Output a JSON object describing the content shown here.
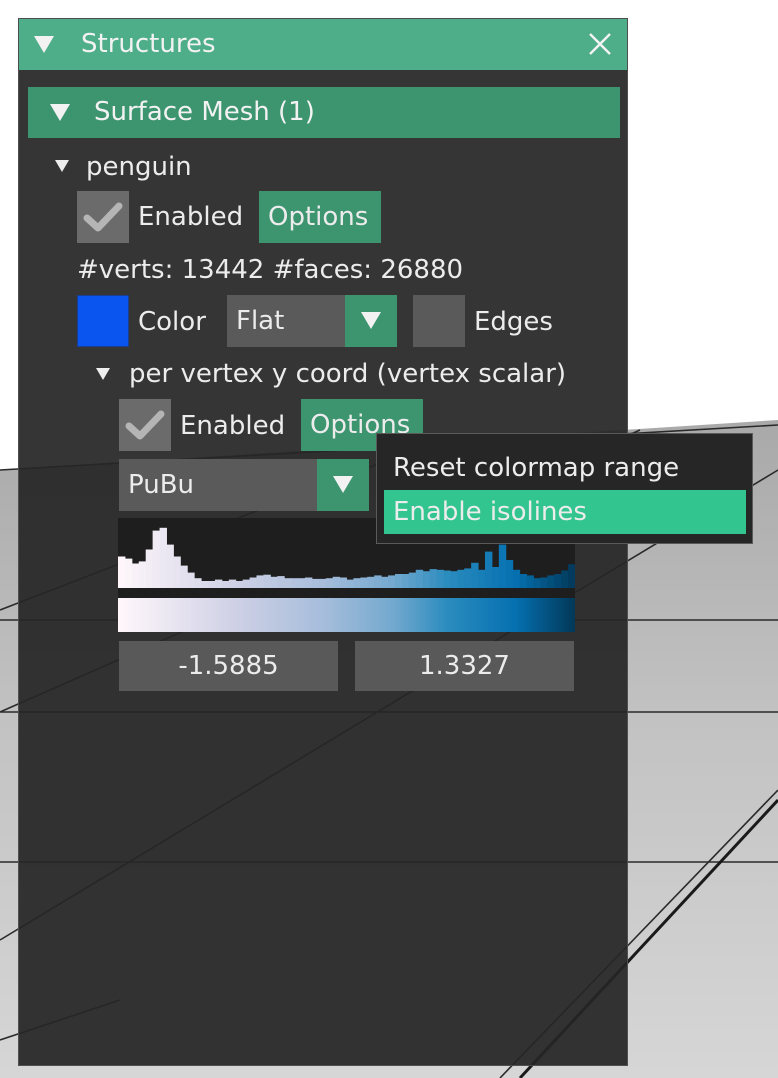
{
  "panel": {
    "title": "Structures",
    "group_header": "Surface Mesh (1)",
    "structure": {
      "name": "penguin",
      "enabled_label": "Enabled",
      "enabled_checked": true,
      "options_label": "Options",
      "stats": "#verts: 13442  #faces: 26880",
      "color_label": "Color",
      "color_value": "#0a55f0",
      "shade_mode": "Flat",
      "edges_label": "Edges",
      "edges_checked": false,
      "quantity": {
        "name": "per vertex y coord (vertex scalar)",
        "enabled_label": "Enabled",
        "enabled_checked": true,
        "options_label": "Options",
        "colormap": "PuBu",
        "range_min": "-1.5885",
        "range_max": "1.3327",
        "histogram": [
          0.45,
          0.42,
          0.35,
          0.38,
          0.55,
          0.82,
          0.86,
          0.62,
          0.45,
          0.32,
          0.22,
          0.14,
          0.1,
          0.1,
          0.12,
          0.1,
          0.12,
          0.1,
          0.12,
          0.15,
          0.18,
          0.19,
          0.16,
          0.17,
          0.14,
          0.14,
          0.14,
          0.15,
          0.13,
          0.13,
          0.14,
          0.16,
          0.15,
          0.12,
          0.14,
          0.15,
          0.16,
          0.18,
          0.16,
          0.18,
          0.2,
          0.2,
          0.22,
          0.26,
          0.24,
          0.27,
          0.26,
          0.25,
          0.24,
          0.26,
          0.28,
          0.36,
          0.26,
          0.52,
          0.3,
          0.62,
          0.4,
          0.26,
          0.2,
          0.18,
          0.14,
          0.15,
          0.18,
          0.2,
          0.25,
          0.34
        ]
      }
    }
  },
  "popup": {
    "items": [
      {
        "label": "Reset colormap range",
        "highlighted": false
      },
      {
        "label": "Enable isolines",
        "highlighted": true
      }
    ]
  }
}
